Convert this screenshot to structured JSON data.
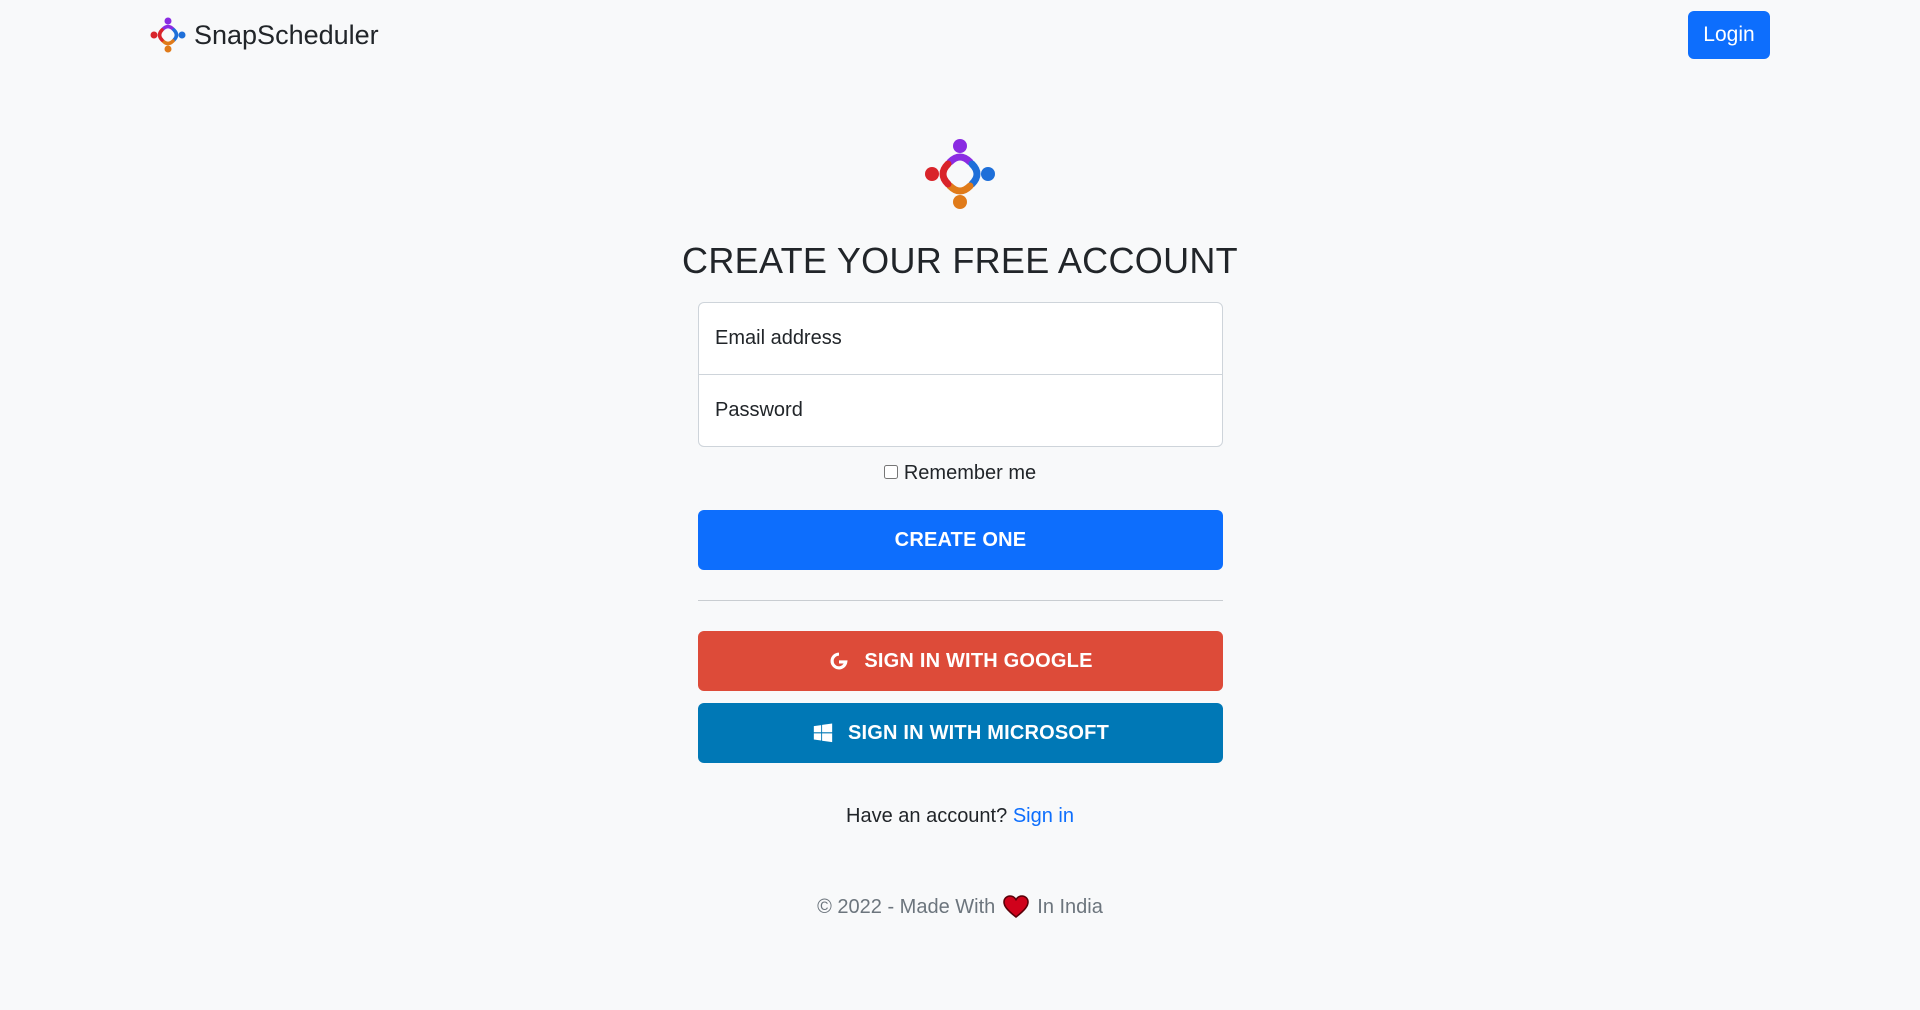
{
  "navbar": {
    "brand_name": "SnapScheduler",
    "login_label": "Login",
    "colors": {
      "primary": "#0d6efd"
    }
  },
  "logo": {
    "icon": "snapscheduler-logo-icon",
    "colors": [
      "#8a2be2",
      "#1e6fd9",
      "#e07b1a",
      "#d9242a"
    ]
  },
  "form": {
    "title": "CREATE YOUR FREE ACCOUNT",
    "email_placeholder": "Email address",
    "password_placeholder": "Password",
    "remember_label": "Remember me",
    "remember_checked": false,
    "create_label": "CREATE ONE",
    "google_label": "SIGN IN WITH GOOGLE",
    "google_icon": "google-icon",
    "google_color": "#dd4b39",
    "microsoft_label": "SIGN IN WITH MICROSOFT",
    "microsoft_icon": "windows-icon",
    "microsoft_color": "#0078b6"
  },
  "signin": {
    "prompt": "Have an account?",
    "link_label": "Sign in"
  },
  "footer": {
    "prefix": "© 2022 - Made With",
    "heart_icon": "heart-icon",
    "suffix": "In India"
  }
}
